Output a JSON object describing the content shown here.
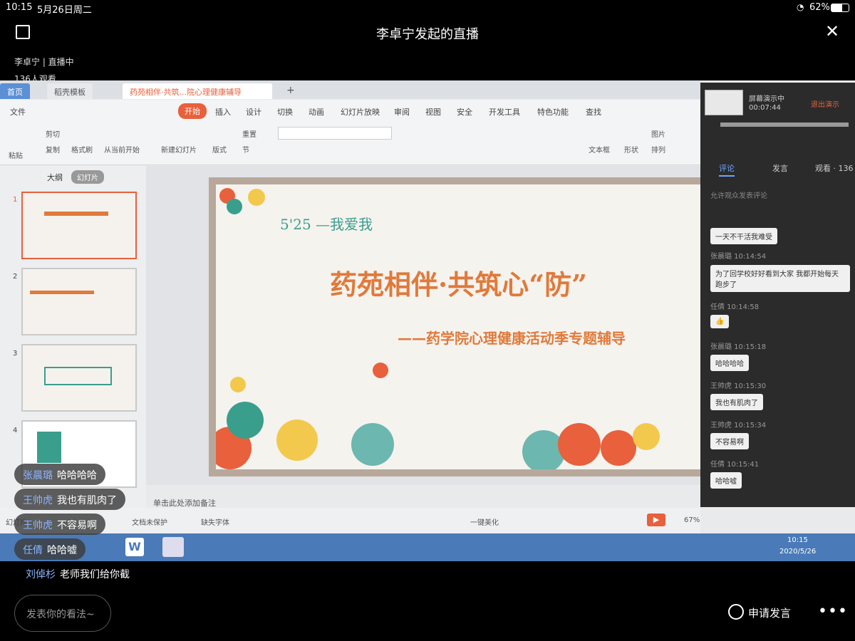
{
  "status": {
    "time": "10:15",
    "date": "5月26日周二",
    "battery": "62%"
  },
  "title": "李卓宁发起的直播",
  "host": "李卓宁 | 直播中",
  "viewers": "136人观看",
  "app": {
    "tabs": [
      "首页",
      "稻壳模板",
      "药苑相伴·共筑...院心理健康辅导"
    ],
    "menu": [
      "文件",
      "开始",
      "插入",
      "设计",
      "切换",
      "动画",
      "幻灯片放映",
      "审阅",
      "视图",
      "安全",
      "开发工具",
      "特色功能",
      "查找"
    ],
    "ribbon": [
      "粘贴",
      "剪切",
      "复制",
      "格式刷",
      "从当前开始",
      "新建幻灯片",
      "版式",
      "重置",
      "节",
      "文本框",
      "形状",
      "图片",
      "排列"
    ],
    "outline_tabs": [
      "大纲",
      "幻灯片"
    ],
    "slide_numbers": [
      "1",
      "2",
      "3",
      "4"
    ],
    "slide": {
      "date": "5'25 —我爱我",
      "title": "药苑相伴·共筑心“防”",
      "subtitle": "——药学院心理健康活动季专题辅导"
    },
    "notes_placeholder": "单击此处添加备注",
    "statusbar": [
      "幻灯片",
      "文档未保护",
      "缺失字体",
      "一键美化",
      "67%"
    ],
    "taskbar": {
      "time": "10:15",
      "date": "2020/5/26"
    }
  },
  "panel": {
    "screen_share": "屏幕演示中",
    "duration": "00:07:44",
    "exit": "退出演示",
    "tabs": [
      "评论",
      "发言",
      "观看 · 136"
    ],
    "allow": "允许观众发表评论",
    "comments": [
      {
        "meta": "",
        "text": "一天不干活我难受"
      },
      {
        "meta": "张晨璐 10:14:54",
        "text": "为了回学校好好看到大家 我都开始每天跑步了"
      },
      {
        "meta": "任倩 10:14:58",
        "text": "👍"
      },
      {
        "meta": "张晨璐 10:15:18",
        "text": "哈哈哈哈"
      },
      {
        "meta": "王帅虎 10:15:30",
        "text": "我也有肌肉了"
      },
      {
        "meta": "王帅虎 10:15:34",
        "text": "不容易啊"
      },
      {
        "meta": "任倩 10:15:41",
        "text": "哈哈嘘"
      }
    ]
  },
  "bubbles": [
    {
      "name": "张晨璐",
      "text": "哈哈哈哈"
    },
    {
      "name": "王帅虎",
      "text": "我也有肌肉了"
    },
    {
      "name": "王帅虎",
      "text": "不容易啊"
    },
    {
      "name": "任倩",
      "text": "哈哈嘘"
    }
  ],
  "latest": {
    "name": "刘倬杉",
    "text": "老师我们给你截"
  },
  "input_placeholder": "发表你的看法~",
  "apply": "申请发言",
  "colors": {
    "accent": "#e8603c",
    "slide_title": "#e07a3c",
    "slide_date": "#3a9e8c",
    "name": "#8ab4ff"
  }
}
